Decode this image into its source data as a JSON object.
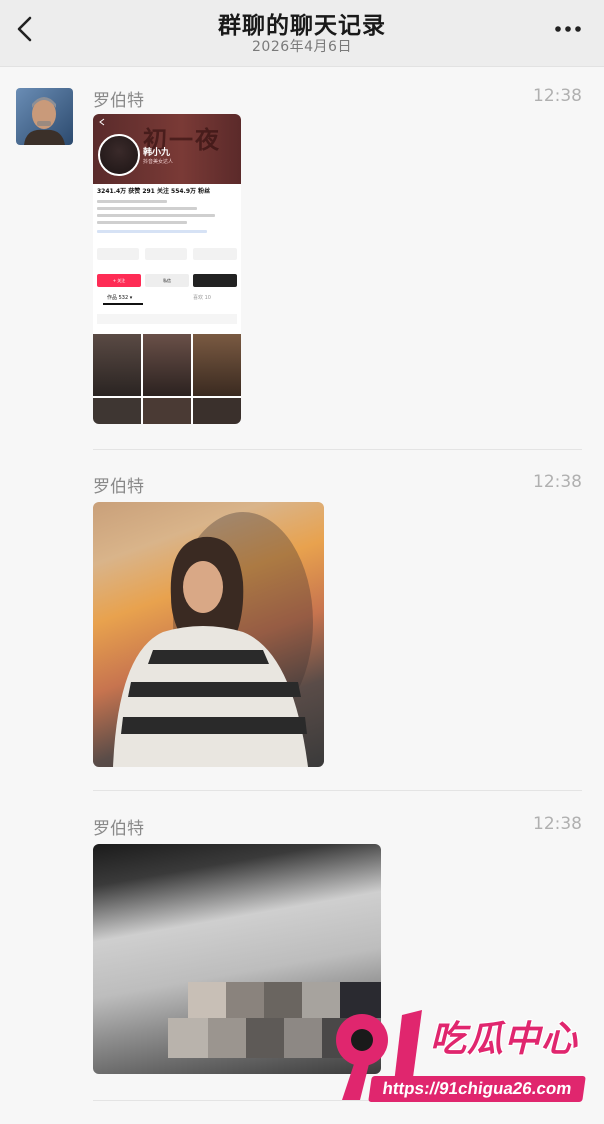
{
  "header": {
    "title": "群聊的聊天记录",
    "date": "2026年4月6日",
    "back_icon": "chevron-left-icon",
    "more_icon": "more-dots-icon"
  },
  "messages": [
    {
      "sender": "罗伯特",
      "time": "12:38",
      "content": "image",
      "image": {
        "banner_text": "初一夜",
        "name": "韩小九",
        "subtitle": "抖音美女达人",
        "stats": "3241.4万 获赞   291 关注   554.9万 粉丝",
        "follow_label": "+ 关注",
        "message_label": "私信",
        "tab_works": "作品 532 ▾",
        "tab_likes": "喜欢 10"
      }
    },
    {
      "sender": "罗伯特",
      "time": "12:38",
      "content": "image"
    },
    {
      "sender": "罗伯特",
      "time": "12:38",
      "content": "image"
    }
  ],
  "watermark": {
    "brand": "吃瓜中心",
    "number": "91",
    "url": "https://91chigua26.com"
  },
  "colors": {
    "header_bg": "#ededed",
    "page_bg": "#f7f7f7",
    "watermark_pink": "#e0266e"
  }
}
